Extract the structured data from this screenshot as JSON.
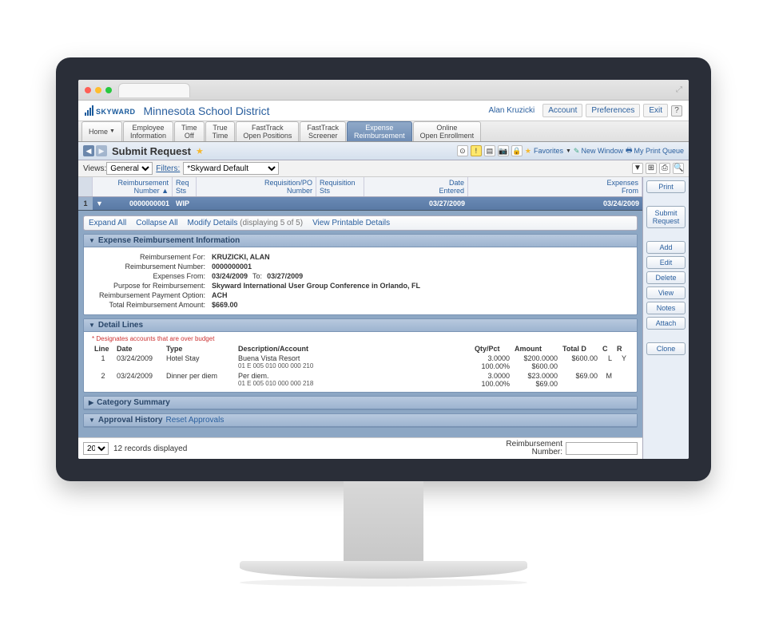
{
  "header": {
    "logo_text": "SKYWARD",
    "district": "Minnesota School District",
    "user": "Alan Kruzicki",
    "links": {
      "account": "Account",
      "preferences": "Preferences",
      "exit": "Exit"
    }
  },
  "tabs": {
    "home": "Home",
    "items": [
      {
        "l1": "Employee",
        "l2": "Information"
      },
      {
        "l1": "Time",
        "l2": "Off"
      },
      {
        "l1": "True",
        "l2": "Time"
      },
      {
        "l1": "FastTrack",
        "l2": "Open Positions"
      },
      {
        "l1": "FastTrack",
        "l2": "Screener"
      },
      {
        "l1": "Expense",
        "l2": "Reimbursement"
      },
      {
        "l1": "Online",
        "l2": "Open Enrollment"
      }
    ],
    "active_index": 5
  },
  "title": {
    "text": "Submit Request",
    "favorites": "Favorites",
    "new_window": "New Window",
    "print_queue": "My Print Queue"
  },
  "filters": {
    "views_lbl": "Views:",
    "views_val": "General",
    "filters_lbl": "Filters:",
    "filters_val": "*Skyward Default",
    "print_btn": "Print"
  },
  "columns": {
    "reimb_no": "Reimbursement\nNumber ▲",
    "req_sts": "Req\nSts",
    "req_po": "Requisition/PO\nNumber",
    "req_sts2": "Requisition\nSts",
    "date_entered": "Date\nEntered",
    "exp_from": "Expenses\nFrom"
  },
  "row": {
    "idx": "1",
    "reimb_no": "0000000001",
    "req_sts": "WIP",
    "date_entered": "03/27/2009",
    "exp_from": "03/24/2009"
  },
  "actions": {
    "expand": "Expand All",
    "collapse": "Collapse All",
    "modify": "Modify Details",
    "modify_sub": "(displaying 5 of 5)",
    "view_print": "View Printable Details"
  },
  "info_panel": {
    "title": "Expense Reimbursement Information",
    "for_lbl": "Reimbursement For:",
    "for_val": "KRUZICKI, ALAN",
    "num_lbl": "Reimbursement Number:",
    "num_val": "0000000001",
    "from_lbl": "Expenses From:",
    "from_val": "03/24/2009",
    "to_lbl": "To:",
    "to_val": "03/27/2009",
    "purpose_lbl": "Purpose for Reimbursement:",
    "purpose_val": "Skyward International User Group Conference in Orlando, FL",
    "payopt_lbl": "Reimbursement Payment Option:",
    "payopt_val": "ACH",
    "total_lbl": "Total Reimbursement Amount:",
    "total_val": "$669.00"
  },
  "detail_lines": {
    "title": "Detail Lines",
    "note": "* Designates accounts that are over budget",
    "hdr": {
      "line": "Line",
      "date": "Date",
      "type": "Type",
      "desc": "Description/Account",
      "qty": "Qty/Pct",
      "amount": "Amount",
      "total": "Total D",
      "c": "C",
      "r": "R"
    },
    "rows": [
      {
        "line": "1",
        "date": "03/24/2009",
        "type": "Hotel Stay",
        "desc": "Buena Vista Resort",
        "acct": "01 E 005 010 000 000 210",
        "qty": "3.0000",
        "pct": "100.00%",
        "amount": "$200.0000",
        "amt2": "$600.00",
        "total": "$600.00",
        "c": "L",
        "r": "Y"
      },
      {
        "line": "2",
        "date": "03/24/2009",
        "type": "Dinner per diem",
        "desc": "Per diem.",
        "acct": "01 E 005 010 000 000 218",
        "qty": "3.0000",
        "pct": "100.00%",
        "amount": "$23.0000",
        "amt2": "$69.00",
        "total": "$69.00",
        "c": "M",
        "r": ""
      }
    ]
  },
  "panels": {
    "category": "Category Summary",
    "approval": "Approval History",
    "reset": "Reset Approvals"
  },
  "right_buttons": {
    "submit1": "Submit",
    "submit2": "Request",
    "add": "Add",
    "edit": "Edit",
    "delete": "Delete",
    "view": "View",
    "notes": "Notes",
    "attach": "Attach",
    "clone": "Clone"
  },
  "footer": {
    "page_size": "20",
    "records": "12 records displayed",
    "search_lbl": "Reimbursement\nNumber:"
  }
}
